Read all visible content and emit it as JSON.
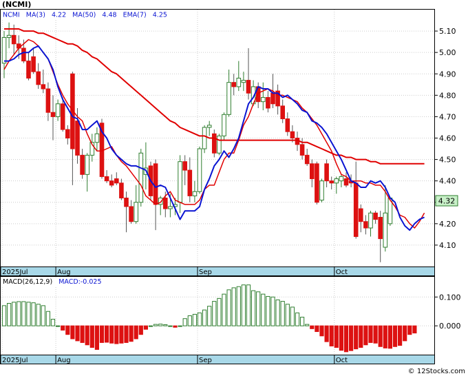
{
  "chart_data": [
    {
      "type": "candlestick",
      "title": "(NCMI)",
      "legend": {
        "ticker": "NCMI",
        "ma3_label": "MA(3)",
        "ma3_value": "4.22",
        "ma50_label": "MA(50)",
        "ma50_value": "4.48",
        "ema7_label": "EMA(7)",
        "ema7_value": "4.25"
      },
      "last_price_label": "4.32",
      "ylim": [
        4.0,
        5.2
      ],
      "y_ticks": [
        "5.10",
        "5.00",
        "4.90",
        "4.80",
        "4.70",
        "4.60",
        "4.50",
        "4.40",
        "4.30",
        "4.20",
        "4.10"
      ],
      "x_tick_labels": [
        "2025Jul",
        "Aug",
        "Sep",
        "Oct"
      ],
      "ohlc": [
        [
          4.95,
          5.1,
          4.88,
          5.07
        ],
        [
          5.07,
          5.14,
          5.02,
          5.08
        ],
        [
          5.08,
          5.13,
          4.99,
          5.04
        ],
        [
          5.04,
          5.08,
          4.97,
          5.02
        ],
        [
          5.02,
          5.06,
          4.95,
          4.96
        ],
        [
          4.96,
          5.0,
          4.87,
          4.88
        ],
        [
          4.98,
          5.02,
          4.9,
          4.91
        ],
        [
          4.91,
          4.95,
          4.83,
          4.85
        ],
        [
          4.85,
          4.92,
          4.81,
          4.83
        ],
        [
          4.83,
          4.86,
          4.68,
          4.72
        ],
        [
          4.72,
          4.8,
          4.59,
          4.7
        ],
        [
          4.7,
          4.78,
          4.68,
          4.76
        ],
        [
          4.76,
          4.79,
          4.63,
          4.64
        ],
        [
          4.64,
          4.66,
          4.57,
          4.6
        ],
        [
          4.9,
          4.91,
          4.38,
          4.55
        ],
        [
          4.68,
          4.74,
          4.48,
          4.52
        ],
        [
          4.52,
          4.55,
          4.41,
          4.43
        ],
        [
          4.43,
          4.53,
          4.35,
          4.52
        ],
        [
          4.52,
          4.62,
          4.49,
          4.58
        ],
        [
          4.58,
          4.65,
          4.54,
          4.62
        ],
        [
          4.67,
          4.69,
          4.41,
          4.42
        ],
        [
          4.42,
          4.45,
          4.39,
          4.4
        ],
        [
          4.4,
          4.43,
          4.37,
          4.38
        ],
        [
          4.41,
          4.44,
          4.38,
          4.39
        ],
        [
          4.39,
          4.41,
          4.31,
          4.32
        ],
        [
          4.32,
          4.35,
          4.16,
          4.28
        ],
        [
          4.28,
          4.31,
          4.2,
          4.21
        ],
        [
          4.21,
          4.38,
          4.2,
          4.3
        ],
        [
          4.3,
          4.55,
          4.28,
          4.53
        ],
        [
          4.43,
          4.58,
          4.36,
          4.46
        ],
        [
          4.47,
          4.49,
          4.31,
          4.33
        ],
        [
          4.48,
          4.5,
          4.17,
          4.29
        ],
        [
          4.29,
          4.33,
          4.24,
          4.32
        ],
        [
          4.32,
          4.35,
          4.23,
          4.27
        ],
        [
          4.27,
          4.34,
          4.23,
          4.28
        ],
        [
          4.28,
          4.32,
          4.24,
          4.29
        ],
        [
          4.3,
          4.52,
          4.25,
          4.49
        ],
        [
          4.49,
          4.52,
          4.38,
          4.45
        ],
        [
          4.45,
          4.51,
          4.3,
          4.33
        ],
        [
          4.33,
          4.4,
          4.3,
          4.35
        ],
        [
          4.35,
          4.56,
          4.34,
          4.55
        ],
        [
          4.55,
          4.66,
          4.53,
          4.65
        ],
        [
          4.65,
          4.68,
          4.61,
          4.66
        ],
        [
          4.62,
          4.64,
          4.51,
          4.53
        ],
        [
          4.53,
          4.62,
          4.52,
          4.61
        ],
        [
          4.61,
          4.72,
          4.59,
          4.71
        ],
        [
          4.71,
          4.92,
          4.7,
          4.86
        ],
        [
          4.86,
          4.9,
          4.8,
          4.84
        ],
        [
          4.84,
          4.96,
          4.82,
          4.88
        ],
        [
          4.86,
          4.91,
          4.82,
          4.87
        ],
        [
          4.87,
          5.02,
          4.78,
          4.81
        ],
        [
          4.76,
          4.87,
          4.75,
          4.84
        ],
        [
          4.84,
          4.86,
          4.74,
          4.77
        ],
        [
          4.77,
          4.86,
          4.73,
          4.79
        ],
        [
          4.79,
          4.82,
          4.72,
          4.74
        ],
        [
          4.81,
          4.9,
          4.74,
          4.76
        ],
        [
          4.82,
          4.85,
          4.71,
          4.75
        ],
        [
          4.75,
          4.78,
          4.67,
          4.69
        ],
        [
          4.69,
          4.72,
          4.61,
          4.63
        ],
        [
          4.63,
          4.66,
          4.58,
          4.6
        ],
        [
          4.6,
          4.63,
          4.54,
          4.57
        ],
        [
          4.57,
          4.6,
          4.5,
          4.52
        ],
        [
          4.52,
          4.55,
          4.47,
          4.48
        ],
        [
          4.48,
          4.5,
          4.37,
          4.41
        ],
        [
          4.48,
          4.49,
          4.29,
          4.3
        ],
        [
          4.31,
          4.41,
          4.3,
          4.4
        ],
        [
          4.48,
          4.5,
          4.37,
          4.4
        ],
        [
          4.4,
          4.42,
          4.36,
          4.39
        ],
        [
          4.39,
          4.42,
          4.34,
          4.41
        ],
        [
          4.4,
          4.43,
          4.37,
          4.42
        ],
        [
          4.41,
          4.44,
          4.37,
          4.38
        ],
        [
          4.4,
          4.43,
          4.37,
          4.39
        ],
        [
          4.39,
          4.49,
          4.13,
          4.14
        ],
        [
          4.27,
          4.29,
          4.16,
          4.21
        ],
        [
          4.21,
          4.24,
          4.15,
          4.18
        ],
        [
          4.18,
          4.26,
          4.14,
          4.25
        ],
        [
          4.25,
          4.26,
          4.2,
          4.22
        ],
        [
          4.23,
          4.26,
          4.02,
          4.13
        ],
        [
          4.09,
          4.38,
          4.07,
          4.25
        ],
        [
          4.2,
          4.32,
          4.19,
          4.32
        ]
      ],
      "ma3": [
        4.96,
        4.96,
        4.97,
        4.99,
        5.0,
        5.0,
        5.02,
        5.03,
        5.0,
        4.97,
        4.92,
        4.84,
        4.78,
        4.74,
        4.7,
        4.69,
        4.64,
        4.64,
        4.66,
        4.68,
        4.63,
        4.6,
        4.55,
        4.52,
        4.5,
        4.48,
        4.47,
        4.47,
        4.46,
        4.45,
        4.4,
        4.37,
        4.38,
        4.37,
        4.32,
        4.27,
        4.22,
        4.26,
        4.26,
        4.26,
        4.28,
        4.36,
        4.41,
        4.47,
        4.5,
        4.54,
        4.51,
        4.55,
        4.6,
        4.68,
        4.76,
        4.79,
        4.84,
        4.83,
        4.83,
        4.81,
        4.81,
        4.79,
        4.8,
        4.78,
        4.76,
        4.73,
        4.72,
        4.68,
        4.67,
        4.65,
        4.62,
        4.58,
        4.54,
        4.5,
        4.45,
        4.4,
        4.39,
        4.37,
        4.37,
        4.4,
        4.39,
        4.4,
        4.37,
        4.32,
        4.3,
        4.23,
        4.19,
        4.17,
        4.2,
        4.22,
        4.23
      ],
      "ma50": [
        5.11,
        5.11,
        5.11,
        5.11,
        5.1,
        5.1,
        5.1,
        5.09,
        5.09,
        5.08,
        5.07,
        5.06,
        5.05,
        5.04,
        5.04,
        5.03,
        5.01,
        5.0,
        4.98,
        4.97,
        4.95,
        4.93,
        4.91,
        4.9,
        4.88,
        4.86,
        4.84,
        4.82,
        4.8,
        4.78,
        4.76,
        4.74,
        4.72,
        4.7,
        4.68,
        4.67,
        4.65,
        4.64,
        4.63,
        4.62,
        4.61,
        4.61,
        4.6,
        4.6,
        4.59,
        4.59,
        4.59,
        4.59,
        4.59,
        4.59,
        4.59,
        4.59,
        4.59,
        4.59,
        4.59,
        4.59,
        4.59,
        4.59,
        4.59,
        4.59,
        4.59,
        4.58,
        4.58,
        4.57,
        4.56,
        4.55,
        4.54,
        4.53,
        4.52,
        4.52,
        4.51,
        4.51,
        4.5,
        4.5,
        4.5,
        4.49,
        4.49,
        4.48,
        4.48,
        4.48,
        4.48,
        4.48,
        4.48,
        4.48,
        4.48,
        4.48,
        4.48
      ],
      "ema7": [
        4.92,
        4.96,
        4.99,
        5.02,
        5.04,
        5.06,
        5.05,
        5.03,
        5.0,
        4.97,
        4.91,
        4.85,
        4.8,
        4.76,
        4.73,
        4.7,
        4.68,
        4.62,
        4.57,
        4.54,
        4.54,
        4.55,
        4.56,
        4.52,
        4.49,
        4.47,
        4.44,
        4.41,
        4.38,
        4.33,
        4.31,
        4.29,
        4.3,
        4.33,
        4.35,
        4.31,
        4.3,
        4.29,
        4.29,
        4.29,
        4.31,
        4.36,
        4.38,
        4.38,
        4.44,
        4.5,
        4.53,
        4.53,
        4.59,
        4.66,
        4.7,
        4.76,
        4.81,
        4.82,
        4.83,
        4.82,
        4.8,
        4.8,
        4.79,
        4.78,
        4.77,
        4.74,
        4.72,
        4.69,
        4.66,
        4.62,
        4.58,
        4.54,
        4.48,
        4.43,
        4.42,
        4.4,
        4.4,
        4.4,
        4.39,
        4.39,
        4.38,
        4.38,
        4.35,
        4.31,
        4.28,
        4.24,
        4.23,
        4.2,
        4.18,
        4.21,
        4.25
      ]
    },
    {
      "type": "bar",
      "title": "MACD(26,12,9)",
      "value_label": "MACD:-0.025",
      "ylim": [
        -0.1,
        0.17
      ],
      "y_ticks": [
        "0.100",
        "0.000"
      ],
      "x_tick_labels": [
        "2025Jul",
        "Aug",
        "Sep",
        "Oct"
      ],
      "values": [
        0.07,
        0.078,
        0.082,
        0.084,
        0.084,
        0.082,
        0.08,
        0.075,
        0.07,
        0.05,
        0.023,
        0.0,
        -0.015,
        -0.03,
        -0.045,
        -0.052,
        -0.058,
        -0.066,
        -0.075,
        -0.082,
        -0.058,
        -0.057,
        -0.06,
        -0.062,
        -0.06,
        -0.058,
        -0.054,
        -0.045,
        -0.03,
        -0.012,
        0.0,
        0.005,
        0.006,
        0.004,
        0.0,
        -0.005,
        0.0,
        0.025,
        0.035,
        0.04,
        0.045,
        0.055,
        0.068,
        0.085,
        0.095,
        0.11,
        0.125,
        0.132,
        0.136,
        0.142,
        0.142,
        0.122,
        0.118,
        0.11,
        0.102,
        0.1,
        0.09,
        0.085,
        0.075,
        0.065,
        0.045,
        0.03,
        0.005,
        -0.01,
        -0.02,
        -0.035,
        -0.055,
        -0.07,
        -0.075,
        -0.085,
        -0.09,
        -0.086,
        -0.08,
        -0.075,
        -0.066,
        -0.058,
        -0.06,
        -0.072,
        -0.077,
        -0.078,
        -0.072,
        -0.068,
        -0.052,
        -0.03,
        -0.025
      ]
    }
  ],
  "colors": {
    "up": "#2e7d2e",
    "down": "#dd1111",
    "ma3": "#0a14d2",
    "ma50": "#e00000",
    "ema7": "#e00000",
    "axis_band": "#a8d8e8",
    "price_tag": "#c8f0c8"
  },
  "watermark": "© 12Stocks.com"
}
